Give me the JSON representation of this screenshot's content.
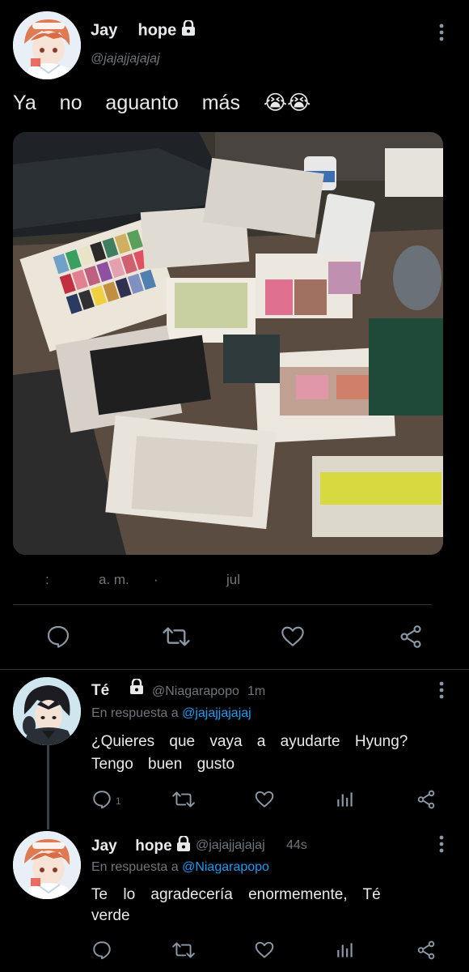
{
  "main_tweet": {
    "name_part1": "Jay",
    "name_part2": "hope",
    "handle": "@jajajjajajaj",
    "text": "Ya no aguanto más 😭😭",
    "meta_colon": ":",
    "meta_ampm": "a. m.",
    "meta_dot": "·",
    "meta_month": "jul",
    "icons": [
      "reply-icon",
      "retweet-icon",
      "like-icon",
      "share-icon"
    ],
    "menu_icon": "more-vertical-icon"
  },
  "reply1": {
    "name": "Té",
    "handle": "@Niagarapopo",
    "time": "1m",
    "reply_prefix": "En respuesta a",
    "reply_to": "@jajajjajajaj",
    "text_line1": "¿Quieres que vaya a ayudarte Hyung?",
    "text_line2": "Tengo buen gusto",
    "reply_count": "1"
  },
  "reply2": {
    "name_part1": "Jay",
    "name_part2": "hope",
    "handle": "@jajajjajajaj",
    "time": "44s",
    "reply_prefix": "En respuesta a",
    "reply_to": "@Niagarapopo",
    "text_line1": "Te lo agradecería enormemente, Té",
    "text_line2": "verde"
  },
  "colors": {
    "background": "#000000",
    "text": "#e7e9ea",
    "muted": "#6e767d",
    "link": "#1d9bf0",
    "divider": "#2f3336"
  }
}
